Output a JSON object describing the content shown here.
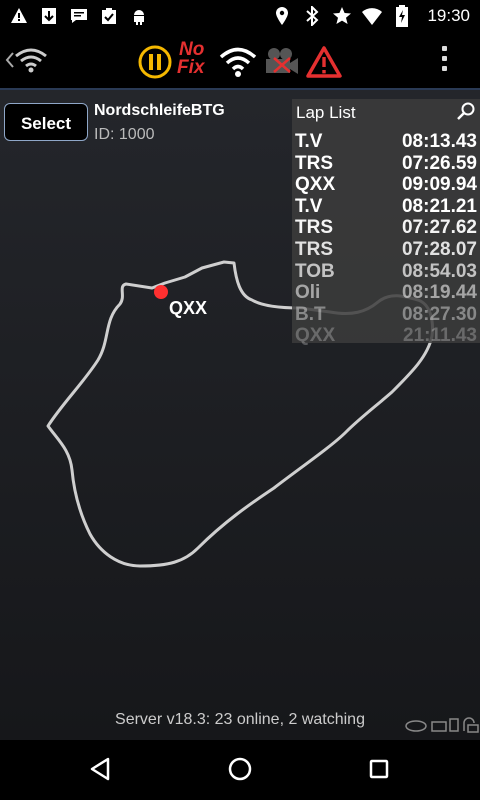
{
  "status_bar": {
    "time": "19:30",
    "left_icons": [
      "warning-icon",
      "download-icon",
      "chat-icon",
      "clipboard-check-icon",
      "android-icon"
    ],
    "right_icons": [
      "location-icon",
      "bluetooth-icon",
      "star-icon",
      "wifi-icon",
      "battery-charging-icon"
    ]
  },
  "toolbar": {
    "icons": [
      "back-chevron-icon",
      "wifi-small-icon",
      "pause-icon",
      "wifi-icon",
      "camera-off-icon",
      "warning-triangle-icon",
      "overflow-menu-icon"
    ],
    "nofix_line1": "No",
    "nofix_line2": "Fix",
    "accent_yellow": "#f5b800",
    "alert_red": "#e53030"
  },
  "session": {
    "select_label": "Select",
    "track_name": "NordschleifeBTG",
    "track_id": "ID: 1000"
  },
  "map": {
    "car_label": "QXX",
    "car_color": "#ff3030"
  },
  "lap_list": {
    "title": "Lap List",
    "rows": [
      {
        "driver": "T.V",
        "time": "08:13.43"
      },
      {
        "driver": "TRS",
        "time": "07:26.59"
      },
      {
        "driver": "QXX",
        "time": "09:09.94"
      },
      {
        "driver": "T.V",
        "time": "08:21.21"
      },
      {
        "driver": "TRS",
        "time": "07:27.62"
      },
      {
        "driver": "TRS",
        "time": "07:28.07"
      },
      {
        "driver": "TOB",
        "time": "08:54.03"
      },
      {
        "driver": "Oli",
        "time": "08:19.44"
      },
      {
        "driver": "B.T",
        "time": "08:27.30"
      },
      {
        "driver": "QXX",
        "time": "21:11.43"
      }
    ]
  },
  "footer": {
    "server_status": "Server v18.3: 23 online, 2 watching"
  },
  "nav_bar": {
    "icons": [
      "back-triangle-icon",
      "home-circle-icon",
      "recents-square-icon"
    ]
  }
}
